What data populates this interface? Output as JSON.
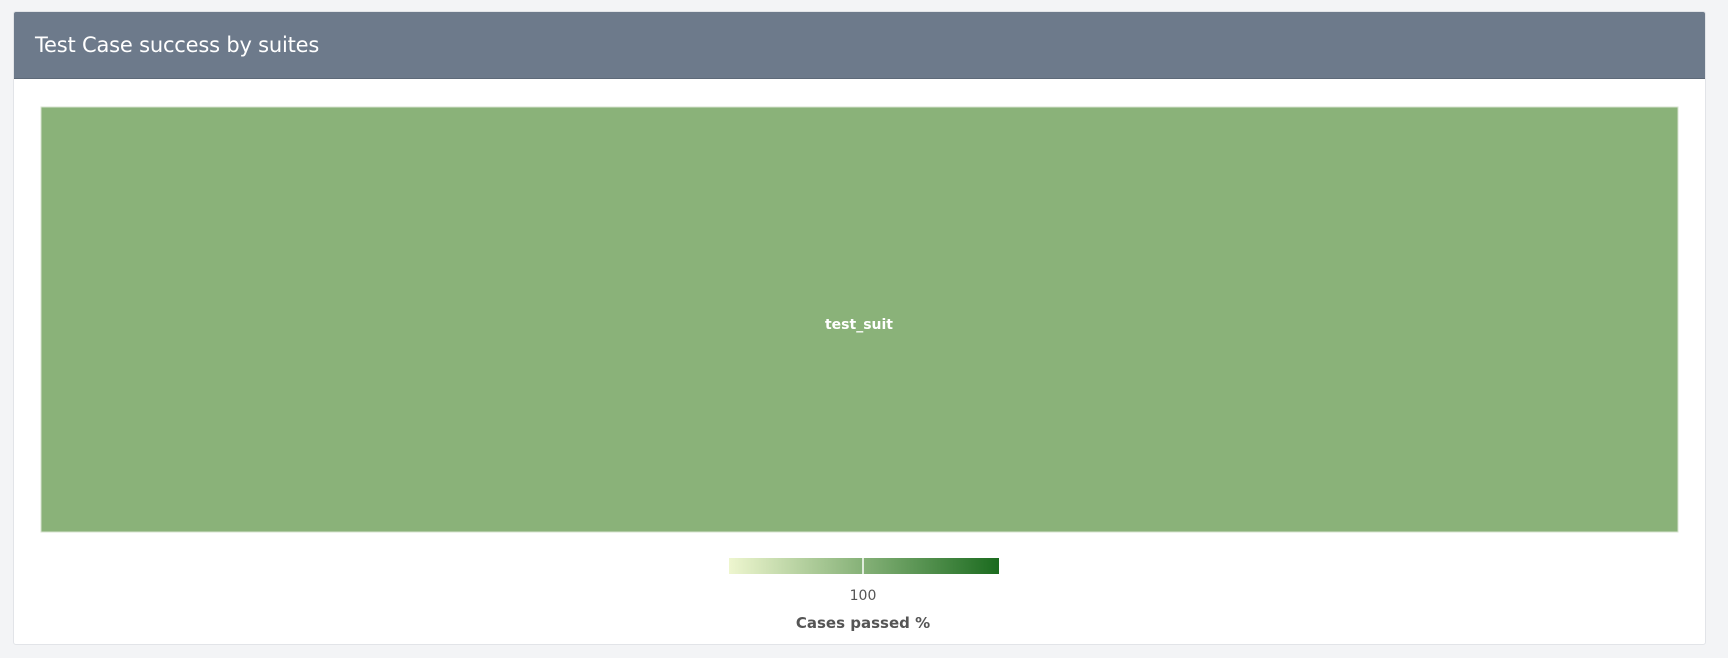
{
  "panel": {
    "title": "Test Case success by suites"
  },
  "chart_data": {
    "type": "heatmap",
    "title": "",
    "items": [
      {
        "name": "test_suit",
        "value": 100
      }
    ],
    "color_axis": {
      "title": "Cases passed %",
      "min_color": "#eef6cf",
      "max_color": "#1b6b1f",
      "tick_labels": [
        "100"
      ]
    },
    "colors": {
      "cell": "#8ab279",
      "cell_border": "#d7e3cf",
      "label": "#ffffff",
      "legend_text": "#555555",
      "legend_title": "#555555"
    }
  }
}
